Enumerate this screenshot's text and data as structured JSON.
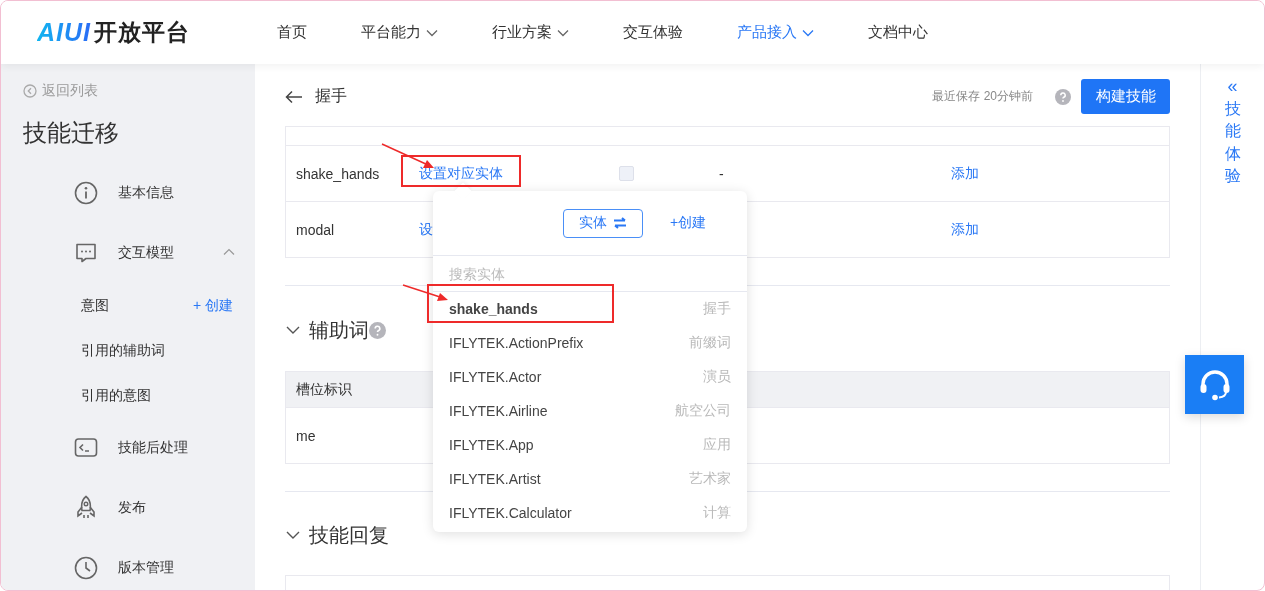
{
  "header": {
    "logo": {
      "mark": "AIUI",
      "text": "开放平台"
    },
    "nav": [
      {
        "label": "首页",
        "dropdown": false,
        "selected": false
      },
      {
        "label": "平台能力",
        "dropdown": true,
        "selected": false
      },
      {
        "label": "行业方案",
        "dropdown": true,
        "selected": false
      },
      {
        "label": "交互体验",
        "dropdown": false,
        "selected": false
      },
      {
        "label": "产品接入",
        "dropdown": true,
        "selected": true
      },
      {
        "label": "文档中心",
        "dropdown": false,
        "selected": false
      }
    ]
  },
  "sidebar": {
    "back": "返回列表",
    "title": "技能迁移",
    "items": [
      {
        "label": "基本信息",
        "kind": "info"
      },
      {
        "label": "交互模型",
        "kind": "chat",
        "expanded": true,
        "children": [
          {
            "label": "意图",
            "action": "+ 创建"
          },
          {
            "label": "引用的辅助词"
          },
          {
            "label": "引用的意图"
          }
        ]
      },
      {
        "label": "技能后处理",
        "kind": "terminal"
      },
      {
        "label": "发布",
        "kind": "rocket"
      },
      {
        "label": "版本管理",
        "kind": "clock"
      }
    ]
  },
  "toolbar": {
    "title": "握手",
    "saved": "最近保存 20分钟前",
    "build_button": "构建技能"
  },
  "slots_table": {
    "rows": [
      {
        "name": "shake_hands",
        "entity_link": "设置对应实体",
        "checked": false,
        "column_4": "-",
        "action": "添加"
      },
      {
        "name": "modal",
        "entity_link": "设",
        "action": "添加"
      }
    ]
  },
  "auxiliary": {
    "title": "辅助词",
    "expanded": true,
    "columns": [
      "槽位标识"
    ],
    "rows": [
      [
        "me"
      ]
    ]
  },
  "reply": {
    "title": "技能回复",
    "expanded": true
  },
  "right_panel": {
    "collapse": "«",
    "label": "技能体验"
  },
  "popup": {
    "type_button": "实体",
    "create": "+创建",
    "search_placeholder": "搜索实体",
    "items": [
      {
        "name": "shake_hands",
        "alias": "握手",
        "selected": true
      },
      {
        "name": "IFLYTEK.ActionPrefix",
        "alias": "前缀词",
        "selected": false
      },
      {
        "name": "IFLYTEK.Actor",
        "alias": "演员",
        "selected": false
      },
      {
        "name": "IFLYTEK.Airline",
        "alias": "航空公司",
        "selected": false
      },
      {
        "name": "IFLYTEK.App",
        "alias": "应用",
        "selected": false
      },
      {
        "name": "IFLYTEK.Artist",
        "alias": "艺术家",
        "selected": false
      },
      {
        "name": "IFLYTEK.Calculator",
        "alias": "计算",
        "selected": false
      }
    ]
  }
}
